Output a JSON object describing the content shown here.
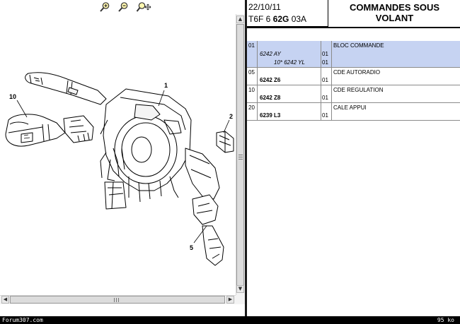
{
  "toolbar": {
    "zoom_in_icon": "magnifier-plus-icon",
    "zoom_out_icon": "magnifier-minus-icon",
    "fit_icon": "magnifier-move-icon"
  },
  "diagram": {
    "callouts": [
      "1",
      "2",
      "5",
      "10"
    ]
  },
  "header": {
    "date": "22/10/11",
    "code_prefix": "T6F 6 ",
    "code_bold": "62G",
    "code_suffix": " 03A",
    "title_line1": "COMMANDES SOUS",
    "title_line2": "VOLANT"
  },
  "parts": [
    {
      "index": "01",
      "ref_line1": "6242 AY",
      "ref_line2": "10* 6242 YL",
      "qty1": "01",
      "qty2": "01",
      "description": "BLOC COMMANDE",
      "selected": true
    },
    {
      "index": "05",
      "ref_line1": "6242 Z6",
      "qty1": "01",
      "description": "CDE AUTORADIO"
    },
    {
      "index": "10",
      "ref_line1": "6242 Z8",
      "qty1": "01",
      "description": "CDE REGULATION"
    },
    {
      "index": "20",
      "ref_line1": "6239 L3",
      "qty1": "01",
      "description": "CALE APPUI"
    }
  ],
  "statusbar": {
    "left": "Forum307.com",
    "right": "95 ko"
  },
  "colors": {
    "selected_row": "#c6d3f2",
    "statusbar_bg": "#000000"
  }
}
